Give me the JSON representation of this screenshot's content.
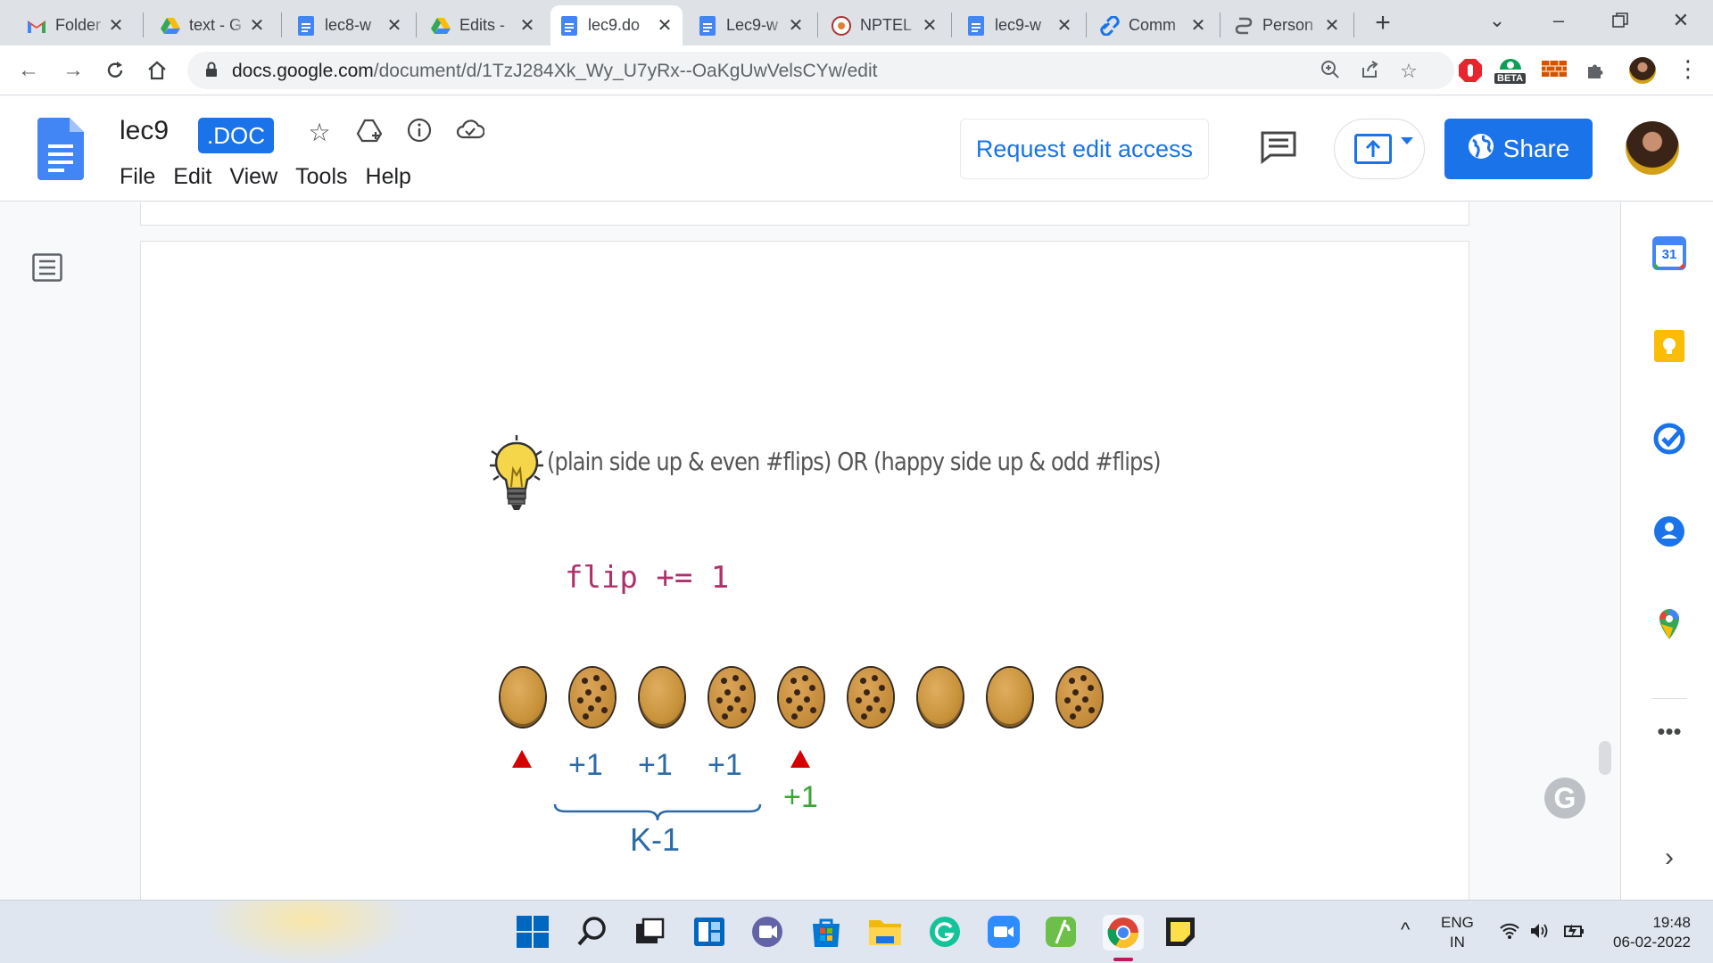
{
  "browser": {
    "tabs": [
      {
        "title": "Folder",
        "icon": "gmail-icon"
      },
      {
        "title": "text - G",
        "icon": "drive-icon"
      },
      {
        "title": "lec8-w",
        "icon": "docs-icon"
      },
      {
        "title": "Edits -",
        "icon": "drive-icon"
      },
      {
        "title": "lec9.do",
        "icon": "docs-icon",
        "active": true
      },
      {
        "title": "Lec9-w",
        "icon": "docs-icon"
      },
      {
        "title": "NPTEL",
        "icon": "nptel-icon"
      },
      {
        "title": "lec9-w",
        "icon": "docs-icon"
      },
      {
        "title": "Comm",
        "icon": "link-icon"
      },
      {
        "title": "Person",
        "icon": "chain-icon"
      }
    ],
    "url_host": "docs.google.com",
    "url_path": "/document/d/1TzJ284Xk_Wy_U7yRx--OaKgUwVelsCYw/edit",
    "extension_badge": "BETA"
  },
  "docs": {
    "title": "lec9",
    "badge": ".DOC",
    "menu": [
      "File",
      "Edit",
      "View",
      "Tools",
      "Help"
    ],
    "request_edit_label": "Request edit access",
    "share_label": "Share",
    "accent": "#1a73e8"
  },
  "figure": {
    "formula": "(plain side up & even #flips) OR (happy side up & odd #flips)",
    "code": "flip += 1",
    "cookies": [
      "plain",
      "choc",
      "plain",
      "choc",
      "choc",
      "choc",
      "plain",
      "plain",
      "choc"
    ],
    "increments": [
      "+1",
      "+1",
      "+1"
    ],
    "green_increment": "+1",
    "brace_label": "K-1"
  },
  "sidebar": {
    "calendar_day": "31"
  },
  "taskbar": {
    "lang_line1": "ENG",
    "lang_line2": "IN",
    "time": "19:48",
    "date": "06-02-2022"
  }
}
